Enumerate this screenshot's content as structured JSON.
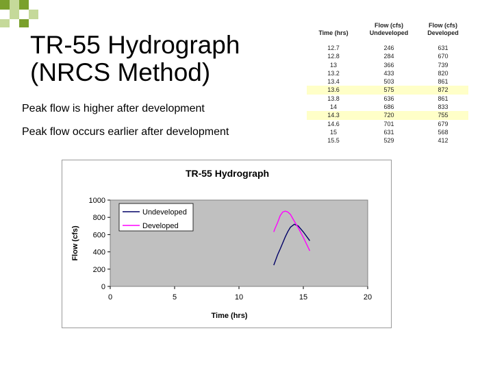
{
  "slide": {
    "title_line1": "TR-55 Hydrograph",
    "title_line2": "(NRCS Method)",
    "bullets": [
      "Peak flow is higher after development",
      "Peak flow occurs earlier after development"
    ]
  },
  "colors": {
    "deco_green": "#7aa02c",
    "deco_light": "#c5d99a",
    "undeveloped": "#000066",
    "developed": "#ff00ff",
    "plot_bg": "#c0c0c0",
    "highlight": "#ffffc8"
  },
  "table": {
    "headers": [
      [
        "Time (hrs)"
      ],
      [
        "Flow (cfs)",
        "Undeveloped"
      ],
      [
        "Flow (cfs)",
        "Developed"
      ]
    ],
    "rows": [
      [
        "12.7",
        "246",
        "631"
      ],
      [
        "12.8",
        "284",
        "670"
      ],
      [
        "13",
        "366",
        "739"
      ],
      [
        "13.2",
        "433",
        "820"
      ],
      [
        "13.4",
        "503",
        "861"
      ],
      [
        "13.6",
        "575",
        "872"
      ],
      [
        "13.8",
        "636",
        "861"
      ],
      [
        "14",
        "686",
        "833"
      ],
      [
        "14.3",
        "720",
        "755"
      ],
      [
        "14.6",
        "701",
        "679"
      ],
      [
        "15",
        "631",
        "568"
      ],
      [
        "15.5",
        "529",
        "412"
      ]
    ],
    "highlight_rows": [
      5,
      8
    ]
  },
  "chart_data": {
    "type": "line",
    "title": "TR-55 Hydrograph",
    "xlabel": "Time (hrs)",
    "ylabel": "Flow (cfs)",
    "xlim": [
      0,
      20
    ],
    "ylim": [
      0,
      1000
    ],
    "xticks": [
      0,
      5,
      10,
      15,
      20
    ],
    "yticks": [
      0,
      200,
      400,
      600,
      800,
      1000
    ],
    "grid": false,
    "legend": "top-left",
    "x": [
      12.7,
      12.8,
      13,
      13.2,
      13.4,
      13.6,
      13.8,
      14,
      14.3,
      14.6,
      15,
      15.5
    ],
    "series": [
      {
        "name": "Undeveloped",
        "color": "#000066",
        "values": [
          246,
          284,
          366,
          433,
          503,
          575,
          636,
          686,
          720,
          701,
          631,
          529
        ]
      },
      {
        "name": "Developed",
        "color": "#ff00ff",
        "values": [
          631,
          670,
          739,
          820,
          861,
          872,
          861,
          833,
          755,
          679,
          568,
          412
        ]
      }
    ]
  }
}
